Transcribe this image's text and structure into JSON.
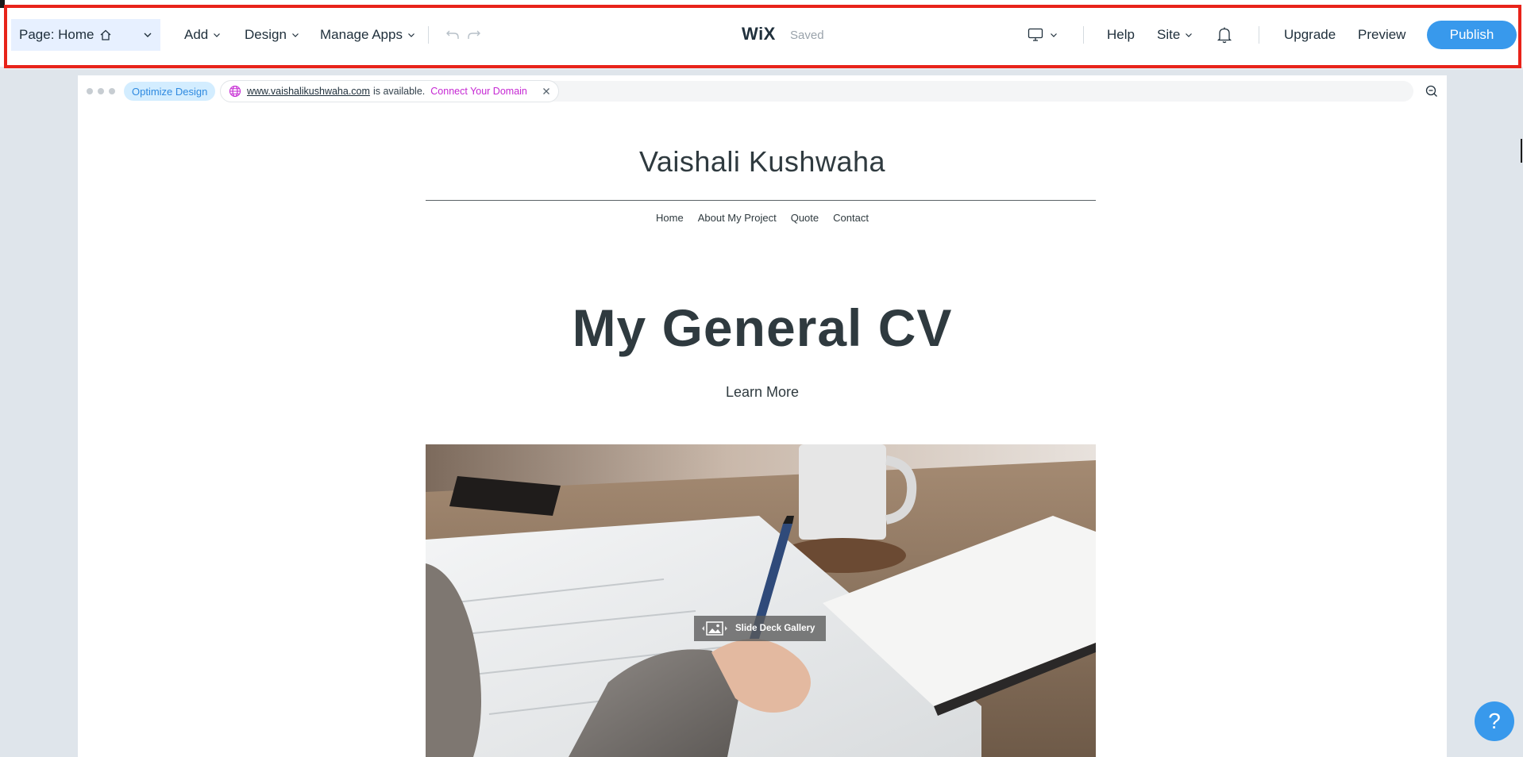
{
  "toolbar": {
    "page_selector": "Page: Home",
    "add": "Add",
    "design": "Design",
    "manage_apps": "Manage Apps",
    "logo": "WiX",
    "save_status": "Saved",
    "help": "Help",
    "site": "Site",
    "upgrade": "Upgrade",
    "preview": "Preview",
    "publish": "Publish"
  },
  "frame_bar": {
    "optimize": "Optimize Design",
    "domain": "www.vaishalikushwaha.com",
    "availability": "is available.",
    "connect": "Connect Your Domain"
  },
  "site": {
    "name": "Vaishali Kushwaha",
    "nav": [
      "Home",
      "About My Project",
      "Quote",
      "Contact"
    ],
    "hero_title": "My General CV",
    "cta": "Learn More",
    "gallery_label": "Slide Deck Gallery"
  },
  "help": {
    "bubble": "?"
  },
  "colors": {
    "accent": "#3899ec",
    "highlight_border": "#e8231a",
    "connect_link": "#c528d3",
    "canvas_background": "#dfe5eb"
  },
  "icons": [
    "home-icon",
    "chevron-down-icon",
    "undo-icon",
    "redo-icon",
    "desktop-icon",
    "bell-icon",
    "globe-icon",
    "close-icon",
    "zoom-out-icon",
    "gallery-image-icon",
    "help-icon"
  ]
}
